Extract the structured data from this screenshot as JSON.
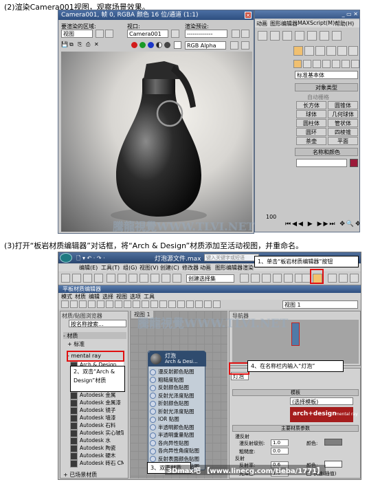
{
  "captions": {
    "step2": "(2)渲染Camera001视图，观察场景效果。",
    "step3": "(3)打开“板岩材质编辑器”对话框，将“Arch & Design”材质添加至活动视图，并重命名。"
  },
  "render_window": {
    "title": "Camera001, 帧 0, RGBA 颜色 16 位/通道 (1:1)",
    "area_label": "要渲染的区域:",
    "area_value": "视图",
    "viewport_label": "视口:",
    "viewport_value": "Camera001",
    "preset_label": "渲染预设:",
    "preset_value": "-------------",
    "channel_value": "RGB Alpha"
  },
  "max_panel_top": {
    "menu_items": [
      "动画",
      "图形编辑器",
      "MAXScript(M)",
      "帮助(H)"
    ],
    "dropdown": "标准基本体",
    "object_type_header": "对象类型",
    "autogrid": "自动栅格",
    "primitives": [
      "长方体",
      "圆锥体",
      "球体",
      "几何球体",
      "圆柱体",
      "管状体",
      "圆环",
      "四棱锥",
      "茶壶",
      "平面"
    ],
    "name_color_header": "名称和颜色",
    "timeline_value": "100"
  },
  "max_window_bottom": {
    "title": "灯泡源文件.max",
    "search_placeholder": "键入关键字或短语",
    "menu_items": [
      "编辑(E)",
      "工具(T)",
      "组(G)",
      "视图(V)",
      "创建(C)",
      "修改器",
      "动画",
      "图形编辑器",
      "渲染"
    ],
    "selection_set": "创建选择集"
  },
  "slate_editor": {
    "title": "平板材质编辑器",
    "menu_items": [
      "模式",
      "材质",
      "编辑",
      "选择",
      "视图",
      "选项",
      "工具"
    ],
    "view_name": "视图 1",
    "browser_header": "材质/贴图浏览器",
    "search_placeholder": "按名称搜索...",
    "materials_group": "- 材质",
    "standard_group": "+ 标准",
    "mental_ray_group": "- mental ray",
    "arch_design_item": "Arch & Design",
    "library_items": [
      "Autodesk 金属",
      "Autodesk 金属漆",
      "Autodesk 镜子",
      "Autodesk 墙漆",
      "Autodesk 石料",
      "Autodesk 实心玻璃",
      "Autodesk 水",
      "Autodesk 陶瓷",
      "Autodesk 硬木",
      "Autodesk 砖石 CMU"
    ],
    "scene_materials": "+ 已场景材质",
    "view_tab": "视图 1",
    "navigator_header": "导航器",
    "node": {
      "title": "灯泡",
      "subtitle": "Arch & Desi...",
      "slots": [
        "漫反射颜色贴图",
        "粗糙度贴图",
        "反射颜色贴图",
        "反射光泽度贴图",
        "折射颜色贴图",
        "折射光泽度贴图",
        "IOR 贴图",
        "半透明颜色贴图",
        "半透明重量贴图",
        "各向异性贴图",
        "各向异性角度贴图",
        "反射表面颜色贴图",
        "折射表面颜色贴图"
      ]
    },
    "params": {
      "name_value": "灯泡",
      "template_header": "模板",
      "template_value": "(选择模板)",
      "brand_text": "arch+design",
      "brand_sub": "mental ray",
      "main_props_header": "主要材质参数",
      "diffuse_header": "漫反射",
      "diffuse_level_label": "漫反射级别:",
      "diffuse_level": "1.0",
      "color_label": "颜色:",
      "roughness_label": "粗糙度:",
      "roughness": "0.0",
      "reflection_header": "反射",
      "reflectivity_label": "反射率:",
      "reflectivity": "0.6",
      "glossiness_label": "光泽度:",
      "glossiness": "1.0",
      "fast_interp": "快速(插值)"
    }
  },
  "callouts": {
    "c1": "1、单击“板岩材质编辑器”按钮",
    "c2": "2、双击“Arch & Design”材质",
    "c3": "3、双击材质",
    "c4": "4、在名称栏内输入“灯泡”"
  },
  "watermarks": {
    "wm1": "騰龍視覺WWW.TLVI.NET",
    "wm2": "騰龍視覺WWW.TLVI.NET",
    "credit": "3Dmax吧 【www.linecg.com/tieba/1771】"
  },
  "colors": {
    "title_blue": "#2e4f80",
    "callout_red": "#e01010",
    "brand_red": "#a51d1d",
    "node_header": "#2f4b6e"
  }
}
